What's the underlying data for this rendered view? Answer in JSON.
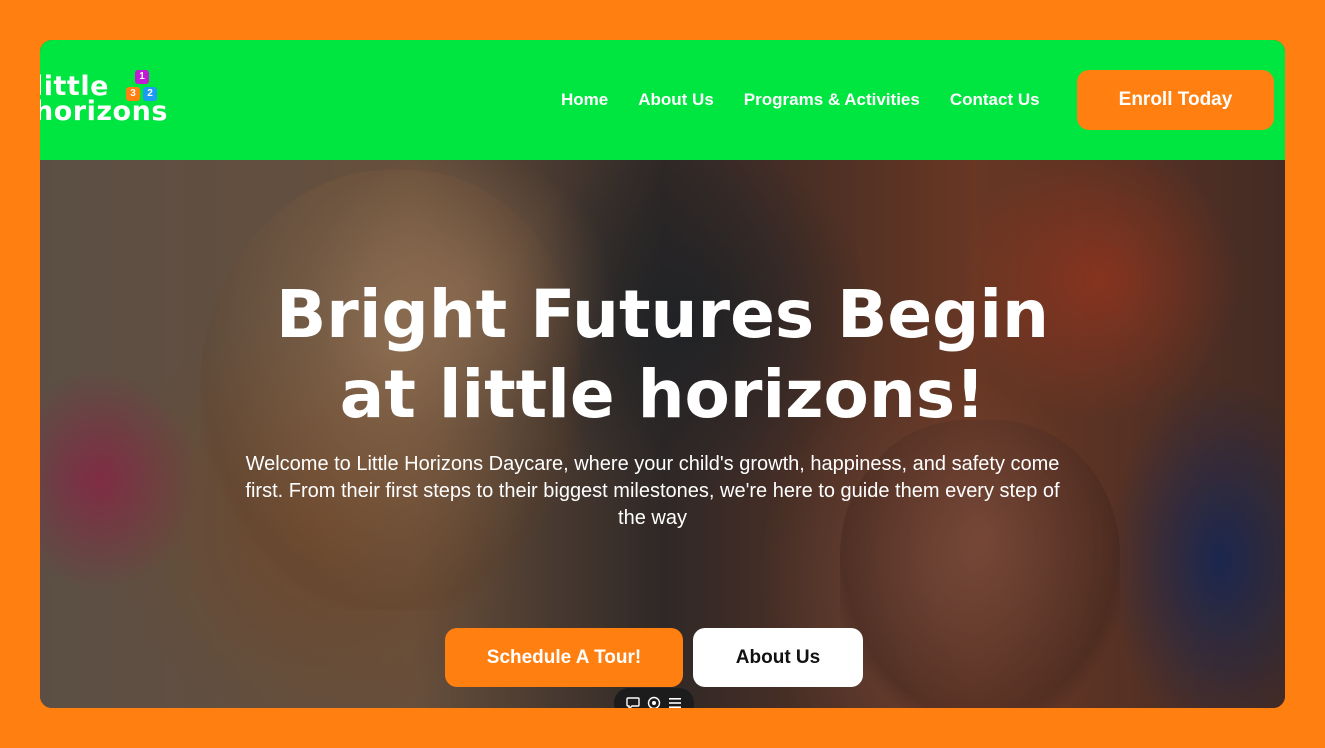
{
  "brand": {
    "logo_line1": "little",
    "logo_line2": "horizons",
    "blocks": [
      "1",
      "3",
      "2"
    ],
    "colors": {
      "header_green": "#00e640",
      "accent_orange": "#ff7f11",
      "white": "#ffffff"
    }
  },
  "nav": {
    "items": [
      "Home",
      "About Us",
      "Programs & Activities",
      "Contact Us"
    ],
    "cta_label": "Enroll Today"
  },
  "hero": {
    "title_line1": "Bright Futures Begin",
    "title_line2": "at little horizons!",
    "description": "Welcome to Little Horizons Daycare, where your child's growth, happiness, and safety come first. From their first steps to their biggest milestones, we're here to guide them every step of the way",
    "primary_button": "Schedule A Tour!",
    "secondary_button": "About Us"
  },
  "toolbar": {
    "icons": [
      "comment-icon",
      "view-icon",
      "menu-icon"
    ]
  }
}
